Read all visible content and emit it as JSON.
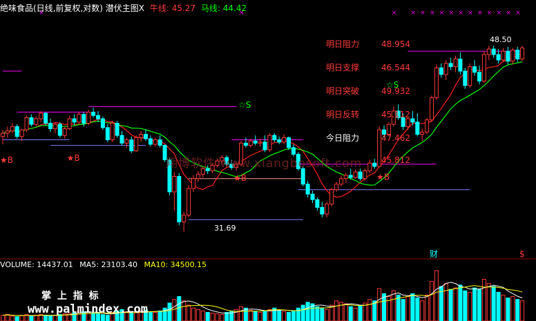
{
  "header": {
    "title": "绝味食品(日线,前复权,对数) 潜伏主图X",
    "niu_label": "牛线: 45.27",
    "ma_label": "马线: 44.42"
  },
  "levels": [
    {
      "label": "明日阻力",
      "value": "48.954",
      "label_color": "#ff3a3a",
      "value_color": "#ff3a3a"
    },
    {
      "label": "明日支撑",
      "value": "46.544",
      "label_color": "#ff3a3a",
      "value_color": "#ff3a3a"
    },
    {
      "label": "明日突破",
      "value": "49.932",
      "label_color": "#ff3a3a",
      "value_color": "#ff3a3a"
    },
    {
      "label": "明日反转",
      "value": "45.112",
      "label_color": "#ff3a3a",
      "value_color": "#ff3a3a"
    },
    {
      "label": "今日阻力",
      "value": "47.462",
      "label_color": "#ffffff",
      "value_color": "#ff3a3a"
    },
    {
      "label": "",
      "value": "45.812",
      "label_color": "#ffffff",
      "value_color": "#ff3a3a"
    }
  ],
  "annotations": {
    "high": "48.50",
    "low": "31.69",
    "buy": "B",
    "sell": "S",
    "cai": "财",
    "dollar": "$",
    "watermark": "翔博软件 www.xiangbosoft.com"
  },
  "volume_panel": {
    "volume_label": "VOLUME: 14437.01",
    "ma5_label": "MA5: 23103.40",
    "ma10_label": "MA10: 34500.15",
    "logo_text": "掌 上 指 标",
    "logo_url": "www.palmindex.com"
  },
  "colors": {
    "up": "#ff3a3a",
    "down": "#00ffff",
    "niu": "#ff2020",
    "ma": "#00ff00",
    "magenta": "#ff00ff",
    "blue_line": "#8080ff",
    "ma5": "#ffffff",
    "ma10": "#ffff00"
  },
  "chart_data": {
    "type": "candlestick",
    "price_range": [
      30.5,
      51.5
    ],
    "candles": [
      [
        40.3,
        40.9,
        39.6,
        40.6
      ],
      [
        40.6,
        41.2,
        40.2,
        40.8
      ],
      [
        40.8,
        41.5,
        40.6,
        41.2
      ],
      [
        41.2,
        41.4,
        40.1,
        40.3
      ],
      [
        40.3,
        41.0,
        39.9,
        40.9
      ],
      [
        40.9,
        42.2,
        40.7,
        42.0
      ],
      [
        42.0,
        42.3,
        41.2,
        41.4
      ],
      [
        41.4,
        42.1,
        41.2,
        41.9
      ],
      [
        41.9,
        42.6,
        41.6,
        42.4
      ],
      [
        42.4,
        42.5,
        41.3,
        41.5
      ],
      [
        41.5,
        41.9,
        40.7,
        41.0
      ],
      [
        41.0,
        41.6,
        40.6,
        41.4
      ],
      [
        41.4,
        41.6,
        40.2,
        40.4
      ],
      [
        40.4,
        41.2,
        40.1,
        41.0
      ],
      [
        41.0,
        42.2,
        40.9,
        41.9
      ],
      [
        41.9,
        42.3,
        41.3,
        41.6
      ],
      [
        41.6,
        42.5,
        41.4,
        42.3
      ],
      [
        42.3,
        42.5,
        41.2,
        41.5
      ],
      [
        41.5,
        42.7,
        41.3,
        42.5
      ],
      [
        42.5,
        42.9,
        42.0,
        42.2
      ],
      [
        42.2,
        42.6,
        41.6,
        41.9
      ],
      [
        41.9,
        42.1,
        40.9,
        41.1
      ],
      [
        41.1,
        41.4,
        39.8,
        40.0
      ],
      [
        40.0,
        41.7,
        39.8,
        41.5
      ],
      [
        41.5,
        41.7,
        40.2,
        40.4
      ],
      [
        40.4,
        40.8,
        39.5,
        39.7
      ],
      [
        39.7,
        40.2,
        39.3,
        40.0
      ],
      [
        40.0,
        40.3,
        38.8,
        39.0
      ],
      [
        39.0,
        40.4,
        38.9,
        40.2
      ],
      [
        40.2,
        40.8,
        39.8,
        40.5
      ],
      [
        40.5,
        40.9,
        39.9,
        40.1
      ],
      [
        40.1,
        40.4,
        39.4,
        39.6
      ],
      [
        39.6,
        40.2,
        39.4,
        40.0
      ],
      [
        40.0,
        40.4,
        39.3,
        39.5
      ],
      [
        39.5,
        39.6,
        38.0,
        38.2
      ],
      [
        38.2,
        38.4,
        35.0,
        35.3
      ],
      [
        35.3,
        37.1,
        33.6,
        36.7
      ],
      [
        36.7,
        37.0,
        32.3,
        32.6
      ],
      [
        32.6,
        33.5,
        31.7,
        33.2
      ],
      [
        33.2,
        35.9,
        33.0,
        35.6
      ],
      [
        35.6,
        36.8,
        35.3,
        36.5
      ],
      [
        36.5,
        37.2,
        36.2,
        36.9
      ],
      [
        36.9,
        37.6,
        36.6,
        37.4
      ],
      [
        37.4,
        37.7,
        36.9,
        37.2
      ],
      [
        37.2,
        37.9,
        37.0,
        37.7
      ],
      [
        37.7,
        38.3,
        37.5,
        38.1
      ],
      [
        38.1,
        38.6,
        37.8,
        38.4
      ],
      [
        38.4,
        38.6,
        37.6,
        37.8
      ],
      [
        37.8,
        38.2,
        37.3,
        37.5
      ],
      [
        37.5,
        38.0,
        37.2,
        37.8
      ],
      [
        37.8,
        39.9,
        37.6,
        39.7
      ],
      [
        39.7,
        40.2,
        39.3,
        39.5
      ],
      [
        39.5,
        40.1,
        39.3,
        39.9
      ],
      [
        39.9,
        40.4,
        39.5,
        39.7
      ],
      [
        39.7,
        40.1,
        39.4,
        39.8
      ],
      [
        39.8,
        40.4,
        38.9,
        39.1
      ],
      [
        39.1,
        40.6,
        38.9,
        40.4
      ],
      [
        40.4,
        40.6,
        39.8,
        40.0
      ],
      [
        40.0,
        40.3,
        39.6,
        39.8
      ],
      [
        39.8,
        40.5,
        39.6,
        40.2
      ],
      [
        40.2,
        40.3,
        39.1,
        39.3
      ],
      [
        39.3,
        39.6,
        38.5,
        38.7
      ],
      [
        38.7,
        38.9,
        37.2,
        37.4
      ],
      [
        37.4,
        37.6,
        35.8,
        36.0
      ],
      [
        36.0,
        36.3,
        34.8,
        35.1
      ],
      [
        35.1,
        35.4,
        34.3,
        34.6
      ],
      [
        34.6,
        34.8,
        33.6,
        33.9
      ],
      [
        33.9,
        34.4,
        33.0,
        33.3
      ],
      [
        33.3,
        34.4,
        33.0,
        34.2
      ],
      [
        34.2,
        35.7,
        34.0,
        35.5
      ],
      [
        35.5,
        36.2,
        35.3,
        36.0
      ],
      [
        36.0,
        36.8,
        35.8,
        36.5
      ],
      [
        36.5,
        37.0,
        36.1,
        36.8
      ],
      [
        36.8,
        37.4,
        36.4,
        36.6
      ],
      [
        36.6,
        37.3,
        36.5,
        37.1
      ],
      [
        37.1,
        37.4,
        36.3,
        36.5
      ],
      [
        36.5,
        37.4,
        36.3,
        37.2
      ],
      [
        37.2,
        38.2,
        37.0,
        37.9
      ],
      [
        37.9,
        38.3,
        37.4,
        37.6
      ],
      [
        37.6,
        41.2,
        37.5,
        40.9
      ],
      [
        40.9,
        41.3,
        40.2,
        40.5
      ],
      [
        40.5,
        41.6,
        40.3,
        41.4
      ],
      [
        41.4,
        43.0,
        41.2,
        42.6
      ],
      [
        42.6,
        43.2,
        41.8,
        42.0
      ],
      [
        42.0,
        42.4,
        40.9,
        41.2
      ],
      [
        41.2,
        42.1,
        40.9,
        41.9
      ],
      [
        41.9,
        42.6,
        41.3,
        41.6
      ],
      [
        41.6,
        42.4,
        40.3,
        40.5
      ],
      [
        40.5,
        41.0,
        39.9,
        40.7
      ],
      [
        40.7,
        42.0,
        40.5,
        41.8
      ],
      [
        41.8,
        44.0,
        41.6,
        43.8
      ],
      [
        43.8,
        46.8,
        43.6,
        46.5
      ],
      [
        46.5,
        46.9,
        45.6,
        45.9
      ],
      [
        45.9,
        47.2,
        45.4,
        46.9
      ],
      [
        46.9,
        47.4,
        46.3,
        46.6
      ],
      [
        46.6,
        47.6,
        46.1,
        47.3
      ],
      [
        47.3,
        47.9,
        45.9,
        46.2
      ],
      [
        46.2,
        46.5,
        44.6,
        44.9
      ],
      [
        44.9,
        46.9,
        44.7,
        46.6
      ],
      [
        46.6,
        47.2,
        45.8,
        46.1
      ],
      [
        46.1,
        46.7,
        45.0,
        45.3
      ],
      [
        45.3,
        48.0,
        45.1,
        47.7
      ],
      [
        47.7,
        48.5,
        47.2,
        48.2
      ],
      [
        48.2,
        48.5,
        47.4,
        47.7
      ],
      [
        47.7,
        48.2,
        46.9,
        47.2
      ],
      [
        47.2,
        48.3,
        47.0,
        48.0
      ],
      [
        48.0,
        48.4,
        46.8,
        47.1
      ],
      [
        47.1,
        48.3,
        46.8,
        48.1
      ],
      [
        48.1,
        48.4,
        47.0,
        47.3
      ],
      [
        47.3,
        48.5,
        47.1,
        48.3
      ]
    ],
    "volume": [
      8,
      9,
      7,
      6,
      8,
      9,
      7,
      8,
      9,
      8,
      7,
      8,
      9,
      10,
      11,
      12,
      14,
      13,
      12,
      11,
      10,
      9,
      8,
      12,
      14,
      16,
      13,
      11,
      12,
      14,
      15,
      13,
      12,
      14,
      18,
      25,
      30,
      34,
      28,
      22,
      18,
      16,
      14,
      12,
      11,
      10,
      9,
      12,
      14,
      16,
      20,
      18,
      15,
      13,
      12,
      14,
      16,
      18,
      15,
      13,
      12,
      14,
      18,
      22,
      26,
      24,
      20,
      18,
      16,
      22,
      28,
      26,
      24,
      20,
      18,
      22,
      25,
      30,
      28,
      45,
      38,
      34,
      42,
      36,
      30,
      34,
      38,
      32,
      28,
      36,
      55,
      70,
      48,
      52,
      44,
      46,
      50,
      42,
      40,
      46,
      44,
      58,
      52,
      48,
      40,
      36,
      32,
      34,
      30,
      28
    ]
  }
}
